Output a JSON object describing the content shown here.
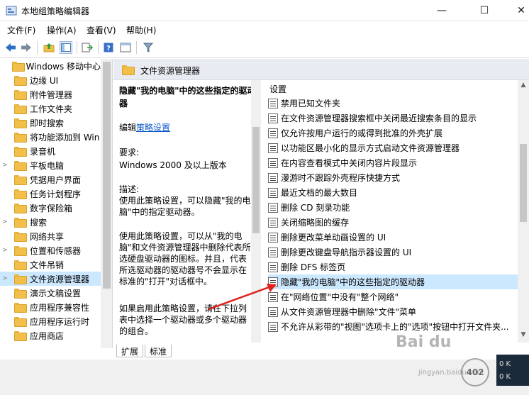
{
  "window": {
    "title": "本地组策略编辑器"
  },
  "window_controls": {
    "minimize": "—",
    "maximize": "☐",
    "close": "✕"
  },
  "menu": [
    "文件(F)",
    "操作(A)",
    "查看(V)",
    "帮助(H)"
  ],
  "tree": {
    "items": [
      {
        "label": "Windows 移动中心",
        "expandable": false
      },
      {
        "label": "边缘 UI",
        "expandable": false
      },
      {
        "label": "附件管理器",
        "expandable": false
      },
      {
        "label": "工作文件夹",
        "expandable": false
      },
      {
        "label": "即时搜索",
        "expandable": false
      },
      {
        "label": "将功能添加到 Win",
        "expandable": false
      },
      {
        "label": "录音机",
        "expandable": false
      },
      {
        "label": "平板电脑",
        "expandable": true
      },
      {
        "label": "凭据用户界面",
        "expandable": false
      },
      {
        "label": "任务计划程序",
        "expandable": false
      },
      {
        "label": "数字保险箱",
        "expandable": false
      },
      {
        "label": "搜索",
        "expandable": true
      },
      {
        "label": "网络共享",
        "expandable": false
      },
      {
        "label": "位置和传感器",
        "expandable": true
      },
      {
        "label": "文件吊销",
        "expandable": false
      },
      {
        "label": "文件资源管理器",
        "expandable": true,
        "selected": true
      },
      {
        "label": "演示文稿设置",
        "expandable": false
      },
      {
        "label": "应用程序兼容性",
        "expandable": false
      },
      {
        "label": "应用程序运行时",
        "expandable": false
      },
      {
        "label": "应用商店",
        "expandable": false
      }
    ]
  },
  "right_header": {
    "title": "文件资源管理器"
  },
  "description": {
    "title": "隐藏\"我的电脑\"中的这些指定的驱动器",
    "edit_prefix": "编辑",
    "edit_link": "策略设置",
    "requirements_label": "要求:",
    "requirements_value": "Windows 2000 及以上版本",
    "desc_label": "描述:",
    "desc_p1": "使用此策略设置，可以隐藏\"我的电脑\"中的指定驱动器。",
    "desc_p2": "使用此策略设置，可以从\"我的电脑\"和文件资源管理器中删除代表所选硬盘驱动器的图标。并且，代表所选驱动器的驱动器号不会显示在标准的\"打开\"对话框中。",
    "desc_p3": "如果启用此策略设置，请在下拉列表中选择一个驱动器或多个驱动器的组合。"
  },
  "settings_list": {
    "header": "设置",
    "items": [
      {
        "label": "禁用已知文件夹"
      },
      {
        "label": "在文件资源管理器搜索框中关闭最近搜索条目的显示"
      },
      {
        "label": "仅允许按用户运行的或得到批准的外壳扩展"
      },
      {
        "label": "以功能区最小化的显示方式启动文件资源管理器"
      },
      {
        "label": "在内容查看模式中关闭内容片段显示"
      },
      {
        "label": "漫游时不跟踪外壳程序快捷方式"
      },
      {
        "label": "最近文档的最大数目"
      },
      {
        "label": "删除 CD 刻录功能"
      },
      {
        "label": "关闭缩略图的缓存"
      },
      {
        "label": "删除更改菜单动画设置的 UI"
      },
      {
        "label": "删除更改键盘导航指示器设置的 UI"
      },
      {
        "label": "删除 DFS 标签页"
      },
      {
        "label": "隐藏\"我的电脑\"中的这些指定的驱动器",
        "selected": true
      },
      {
        "label": "在\"网络位置\"中没有\"整个网络\""
      },
      {
        "label": "从文件资源管理器中删除\"文件\"菜单"
      },
      {
        "label": "不允许从彩带的\"视图\"选项卡上的\"选项\"按钮中打开文件夹..."
      }
    ]
  },
  "tabs": [
    "扩展",
    "标准"
  ],
  "watermark": {
    "main": "Bai du",
    "sub": "jingyan.baidu.com",
    "badge": "402"
  },
  "taskbar_mini": {
    "line1": "0 K",
    "line2": "0 K"
  },
  "colors": {
    "selection": "#cce8ff",
    "link": "#0a58c9",
    "arrow": "#e0201b",
    "folder": "#f2c04a"
  }
}
